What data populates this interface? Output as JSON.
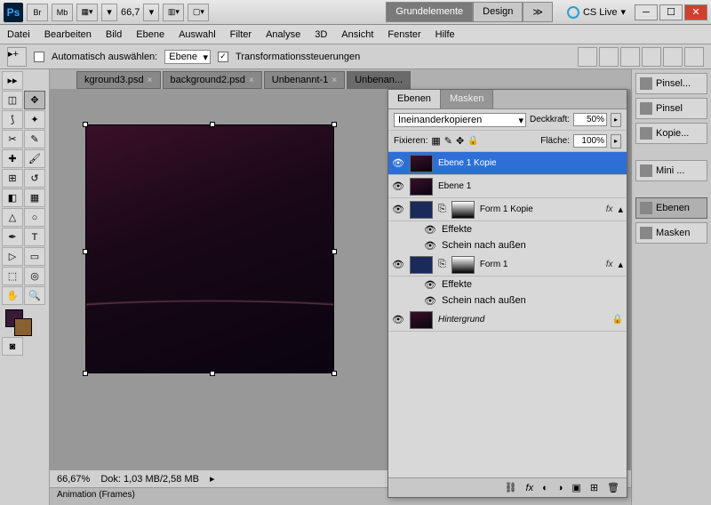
{
  "titlebar": {
    "zoom_value": "66,7",
    "workspace_active": "Grundelemente",
    "workspace_other": "Design",
    "cslive": "CS Live"
  },
  "menu": [
    "Datei",
    "Bearbeiten",
    "Bild",
    "Ebene",
    "Auswahl",
    "Filter",
    "Analyse",
    "3D",
    "Ansicht",
    "Fenster",
    "Hilfe"
  ],
  "options": {
    "auto_select": "Automatisch auswählen:",
    "auto_select_value": "Ebene",
    "transform_controls": "Transformationssteuerungen"
  },
  "doctabs": [
    {
      "label": "kground3.psd"
    },
    {
      "label": "background2.psd"
    },
    {
      "label": "Unbenannt-1"
    },
    {
      "label": "Unbenan..."
    }
  ],
  "status": {
    "zoom": "66,67%",
    "docinfo": "Dok: 1,03 MB/2,58 MB"
  },
  "bottom_tab": "Animation (Frames)",
  "layers_panel": {
    "tab_layers": "Ebenen",
    "tab_masks": "Masken",
    "blend_mode": "Ineinanderkopieren",
    "opacity_label": "Deckkraft:",
    "opacity_value": "50%",
    "lock_label": "Fixieren:",
    "fill_label": "Fläche:",
    "fill_value": "100%",
    "layers": [
      {
        "name": "Ebene 1 Kopie",
        "selected": true
      },
      {
        "name": "Ebene 1"
      },
      {
        "name": "Form 1 Kopie",
        "fx": true,
        "shape": true
      },
      {
        "name": "Form 1",
        "fx": true,
        "shape": true
      },
      {
        "name": "Hintergrund",
        "locked": true,
        "italic": true
      }
    ],
    "effects_label": "Effekte",
    "glow_label": "Schein nach außen"
  },
  "dock": {
    "items": [
      "Pinsel...",
      "Pinsel",
      "Kopie...",
      "Mini ...",
      "Ebenen",
      "Masken"
    ]
  }
}
